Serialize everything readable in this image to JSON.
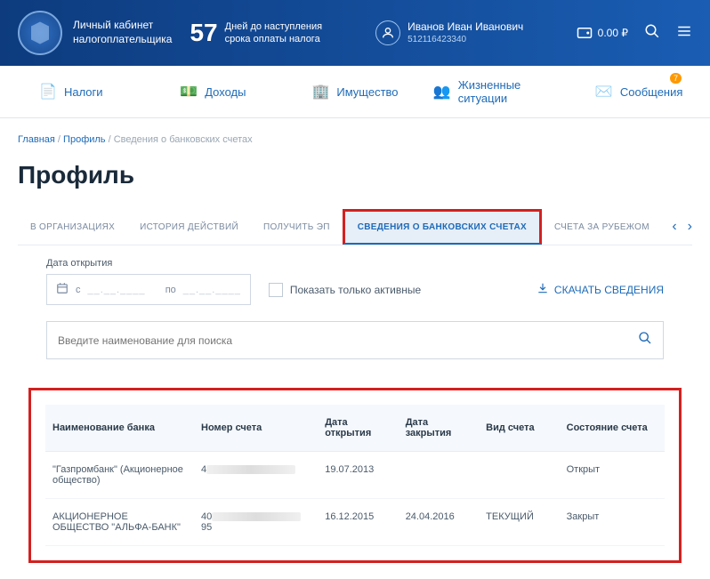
{
  "header": {
    "siteTitle1": "Личный кабинет",
    "siteTitle2": "налогоплательщика",
    "countdown": "57",
    "countdownText1": "Дней до наступления",
    "countdownText2": "срока оплаты налога",
    "userName": "Иванов Иван Иванович",
    "userId": "512116423340",
    "balance": "0.00 ₽"
  },
  "nav": [
    {
      "label": "Налоги"
    },
    {
      "label": "Доходы"
    },
    {
      "label": "Имущество"
    },
    {
      "label": "Жизненные ситуации"
    },
    {
      "label": "Сообщения",
      "badge": "7"
    }
  ],
  "breadcrumb": {
    "home": "Главная",
    "profile": "Профиль",
    "current": "Сведения о банковских счетах"
  },
  "pageTitle": "Профиль",
  "tabs": [
    {
      "label": "В ОРГАНИЗАЦИЯХ"
    },
    {
      "label": "ИСТОРИЯ ДЕЙСТВИЙ"
    },
    {
      "label": "ПОЛУЧИТЬ ЭП"
    },
    {
      "label": "СВЕДЕНИЯ О БАНКОВСКИХ СЧЕТАХ",
      "active": true
    },
    {
      "label": "СЧЕТА ЗА РУБЕЖОМ"
    }
  ],
  "filters": {
    "dateLabel": "Дата открытия",
    "dateFrom": "с",
    "dateTo": "по",
    "placeholder": "__.__.____",
    "showActive": "Показать только активные",
    "download": "СКАЧАТЬ СВЕДЕНИЯ",
    "searchPlaceholder": "Введите наименование для поиска"
  },
  "table": {
    "headers": {
      "bank": "Наименование банка",
      "account": "Номер счета",
      "open": "Дата открытия",
      "close": "Дата закрытия",
      "type": "Вид счета",
      "status": "Состояние счета"
    },
    "rows": [
      {
        "bank": "\"Газпромбанк\" (Акционерное общество)",
        "acctPrefix": "4",
        "acctSuffix": "",
        "open": "19.07.2013",
        "close": "",
        "type": "",
        "status": "Открыт"
      },
      {
        "bank": "АКЦИОНЕРНОЕ ОБЩЕСТВО \"АЛЬФА-БАНК\"",
        "acctPrefix": "40",
        "acctSuffix": "95",
        "open": "16.12.2015",
        "close": "24.04.2016",
        "type": "ТЕКУЩИЙ",
        "status": "Закрыт"
      }
    ]
  }
}
